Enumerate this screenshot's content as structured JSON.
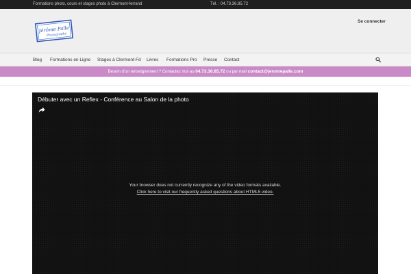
{
  "topbar": {
    "tagline": "Formations photo, cours et stages photo à Clermont-ferrand",
    "phone": "Tél. : 04.73.36.85.72"
  },
  "header": {
    "logo_text_line1": "Jérôme Palle",
    "logo_text_line2": "Photographe",
    "login_label": "Se connecter"
  },
  "nav": {
    "items": [
      {
        "label": "Blog"
      },
      {
        "label": "Formations en Ligne"
      },
      {
        "label": "Stages à Clermont-Fd"
      },
      {
        "label": "Livres"
      },
      {
        "label": "Formations Pro"
      },
      {
        "label": "Presse"
      },
      {
        "label": "Contact"
      }
    ],
    "search_icon": "search-icon"
  },
  "infobar": {
    "text_before": "Besoin d'un renseignement ? Contactez moi au ",
    "phone": "04.73.36.85.72",
    "text_middle": " ou par mail ",
    "email": "contact@jeromepalle.com"
  },
  "video": {
    "title": "Débuter avec un Reflex - Conférence au Salon de la photo",
    "share_icon": "share-icon",
    "message_line1": "Your browser does not currently recognize any of the video formats available.",
    "message_link": "Click here to visit our frequently asked questions about HTML5 video."
  },
  "colors": {
    "topbar_bg": "#1f1f1f",
    "header_bg": "#efefef",
    "infobar_bg": "#c98ac7",
    "video_bg": "#111111"
  }
}
